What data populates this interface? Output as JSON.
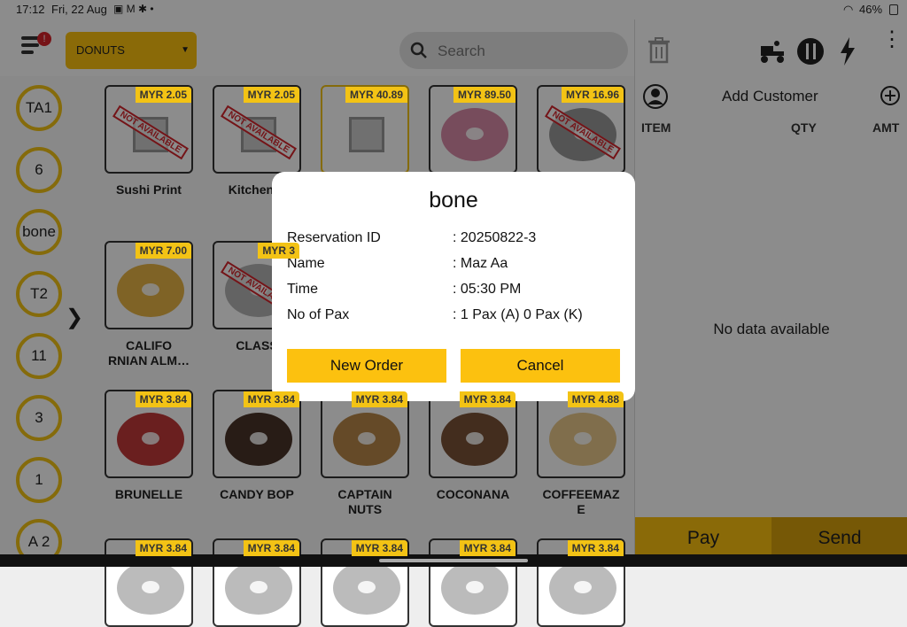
{
  "status_bar": {
    "time": "17:12",
    "date": "Fri, 22 Aug",
    "battery": "46%"
  },
  "header": {
    "menu_badge": "!",
    "category": "DONUTS",
    "search_placeholder": "Search"
  },
  "tables": [
    "TA1",
    "6",
    "bone",
    "T2",
    "11",
    "3",
    "1",
    "A 2"
  ],
  "products": [
    {
      "name": "Sushi Print",
      "price": "MYR 2.05",
      "available": false,
      "image": "placeholder-icon"
    },
    {
      "name": "Kitchen P",
      "price": "MYR 2.05",
      "available": false,
      "image": "placeholder-icon"
    },
    {
      "name": "",
      "price": "MYR 40.89",
      "available": true,
      "image": "placeholder-icon"
    },
    {
      "name": "",
      "price": "MYR 89.50",
      "available": true,
      "image": "pink-donut",
      "color": "#d98aa8"
    },
    {
      "name": "",
      "price": "MYR 16.96",
      "available": false,
      "image": "grey-donut",
      "color": "#999999"
    },
    {
      "name": "CALIFO\nRNIAN ALM…",
      "price": "MYR 7.00",
      "available": true,
      "image": "almond-donut",
      "color": "#e8b546"
    },
    {
      "name": "CLASS",
      "price": "MYR 3",
      "available": false,
      "image": "grey-donut",
      "color": "#b5b5b5"
    },
    {
      "name": "BRUNELLE",
      "price": "MYR 3.84",
      "available": true,
      "image": "red-donut",
      "color": "#c23a3a"
    },
    {
      "name": "CANDY BOP",
      "price": "MYR 3.84",
      "available": true,
      "image": "chocolate-donut",
      "color": "#4a3328"
    },
    {
      "name": "CAPTAIN\nNUTS",
      "price": "MYR 3.84",
      "available": true,
      "image": "nut-donut",
      "color": "#b8884a"
    },
    {
      "name": "COCONANA",
      "price": "MYR 3.84",
      "available": true,
      "image": "coconut-donut",
      "color": "#7a5238"
    },
    {
      "name": "COFFEEMAZ\nE",
      "price": "MYR 4.88",
      "available": true,
      "image": "coffee-donut",
      "color": "#e9c98a"
    },
    {
      "name": "",
      "price": "MYR 3.84",
      "available": true,
      "image": "donut",
      "color": "#bbbbbb"
    },
    {
      "name": "",
      "price": "MYR 3.84",
      "available": true,
      "image": "donut",
      "color": "#bbbbbb"
    },
    {
      "name": "",
      "price": "MYR 3.84",
      "available": true,
      "image": "donut",
      "color": "#bbbbbb"
    },
    {
      "name": "",
      "price": "MYR 3.84",
      "available": true,
      "image": "donut",
      "color": "#bbbbbb"
    },
    {
      "name": "",
      "price": "MYR 3.84",
      "available": true,
      "image": "donut",
      "color": "#bbbbbb"
    }
  ],
  "not_available_label": "NOT AVAILABLE",
  "order_panel": {
    "add_customer": "Add Customer",
    "columns": {
      "item": "ITEM",
      "qty": "QTY",
      "amt": "AMT"
    },
    "empty": "No data available",
    "pay": "Pay",
    "send": "Send"
  },
  "dialog": {
    "title": "bone",
    "rows": [
      {
        "label": "Reservation ID",
        "value": ": 20250822-3"
      },
      {
        "label": "Name",
        "value": ": Maz Aa"
      },
      {
        "label": "Time",
        "value": ": 05:30 PM"
      },
      {
        "label": "No of Pax",
        "value": ": 1 Pax (A) 0 Pax (K)"
      }
    ],
    "new_order": "New Order",
    "cancel": "Cancel"
  },
  "colors": {
    "accent": "#fcc10f",
    "overlay": "rgba(0,0,0,0.45)",
    "not_available": "#d4262c"
  }
}
